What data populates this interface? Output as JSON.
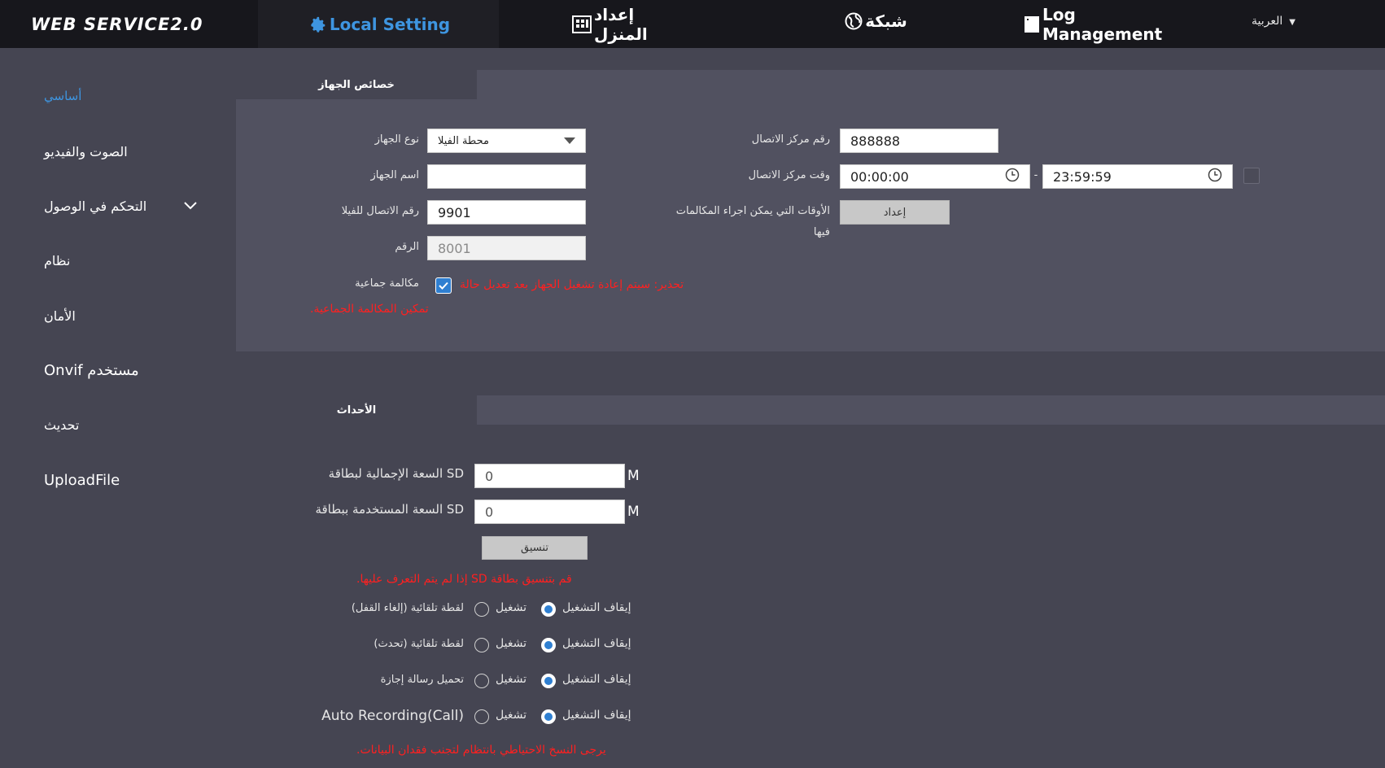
{
  "header": {
    "brand": "WEB SERVICE2.0",
    "nav": {
      "local_setting": "Local Setting",
      "home_setting": "إعداد المنزل",
      "network": "شبكة",
      "log_management": "Log Management"
    },
    "language": "العربية"
  },
  "sidebar": {
    "items": [
      "أساسي",
      "الصوت والفيديو",
      "التحكم في الوصول",
      "نظام",
      "الأمان",
      "Onvif مستخدم",
      "تحديث",
      "UploadFile"
    ]
  },
  "device": {
    "section_title": "خصائص الجهاز",
    "device_type_label": "نوع الجهاز",
    "device_type_value": "محطة الفيلا",
    "device_name_label": "اسم الجهاز",
    "device_name_value": "",
    "villa_number_label": "رقم الاتصال للفيلا",
    "villa_number_value": "9901",
    "number_label": "الرقم",
    "number_value": "8001",
    "group_call_label": "مكالمة جماعية",
    "group_call_checked": true,
    "group_call_warning": "تحذير: سيتم إعادة تشغيل الجهاز بعد تعديل حالة",
    "group_call_warning2": ".تمكين المكالمة الجماعية",
    "call_center_number_label": "رقم مركز الاتصال",
    "call_center_number_value": "888888",
    "call_center_time_label": "وقت مركز الاتصال",
    "time_start": "00:00:00",
    "time_sep": "-",
    "time_end": "23:59:59",
    "callable_times_label_1": "الأوقات التي يمكن اجراء المكالمات",
    "callable_times_label_2": "فيها",
    "setup_button": "إعداد"
  },
  "events": {
    "section_title": "الأحداث",
    "sd_total_label": "السعة الإجمالية لبطاقة SD",
    "sd_total_value": "0",
    "sd_used_label": "السعة المستخدمة ببطاقة SD",
    "sd_used_value": "0",
    "unit": "M",
    "format_button": "تنسيق",
    "format_warning": ".إذا لم يتم التعرف عليها SD قم بتنسيق بطاقة",
    "on_label": "تشغيل",
    "off_label": "إيقاف التشغيل",
    "options": [
      {
        "label": "لقطة تلقائية (إلغاء القفل)",
        "state": "off"
      },
      {
        "label": "لقطة تلقائية (تحدث)",
        "state": "off"
      },
      {
        "label": "تحميل رسالة إجازة",
        "state": "off"
      },
      {
        "label": "Auto Recording(Call)",
        "state": "off"
      }
    ],
    "backup_warning": ".يرجى النسخ الاحتياطي بانتظام لتجنب فقدان البيانات"
  },
  "colors": {
    "topbar": "#17171c",
    "accent": "#3e95e0",
    "background": "#454552",
    "panel": "#515160",
    "warning": "#ff2020"
  }
}
